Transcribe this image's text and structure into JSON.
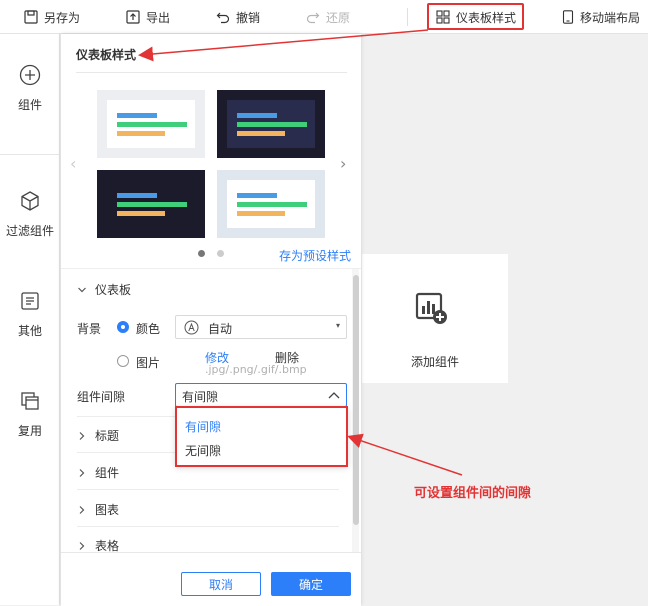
{
  "toolbar": {
    "save_as": "另存为",
    "export": "导出",
    "undo": "撤销",
    "redo": "还原",
    "dashboard_style": "仪表板样式",
    "mobile_layout": "移动端布局"
  },
  "left_nav": {
    "component": "组件",
    "filter_component": "过滤组件",
    "other": "其他",
    "reuse": "复用"
  },
  "panel": {
    "title": "仪表板样式",
    "save_preset": "存为预设样式",
    "preset_count": 2,
    "active_preset_page": 1,
    "dashboard_section": "仪表板",
    "background_label": "背景",
    "color_option": "颜色",
    "color_value": "自动",
    "image_option": "图片",
    "modify_link": "修改",
    "delete_link": "删除",
    "image_hint": ".jpg/.png/.gif/.bmp",
    "spacing_label": "组件间隙",
    "spacing_value": "有间隙",
    "sections": [
      "标题",
      "组件",
      "图表",
      "表格"
    ],
    "cancel": "取消",
    "ok": "确定"
  },
  "dropdown": {
    "options": [
      "有间隙",
      "无间隙"
    ],
    "selected": "有间隙"
  },
  "canvas": {
    "add_component": "添加组件"
  },
  "annotation": {
    "text": "可设置组件间的间隙"
  },
  "colors": {
    "accent": "#2d7ff9",
    "highlight": "#e23434",
    "bar_blue": "#4a9be5",
    "bar_green": "#3fcf7a",
    "bar_orange": "#f2b45c",
    "dark_theme": "#1f2140"
  }
}
